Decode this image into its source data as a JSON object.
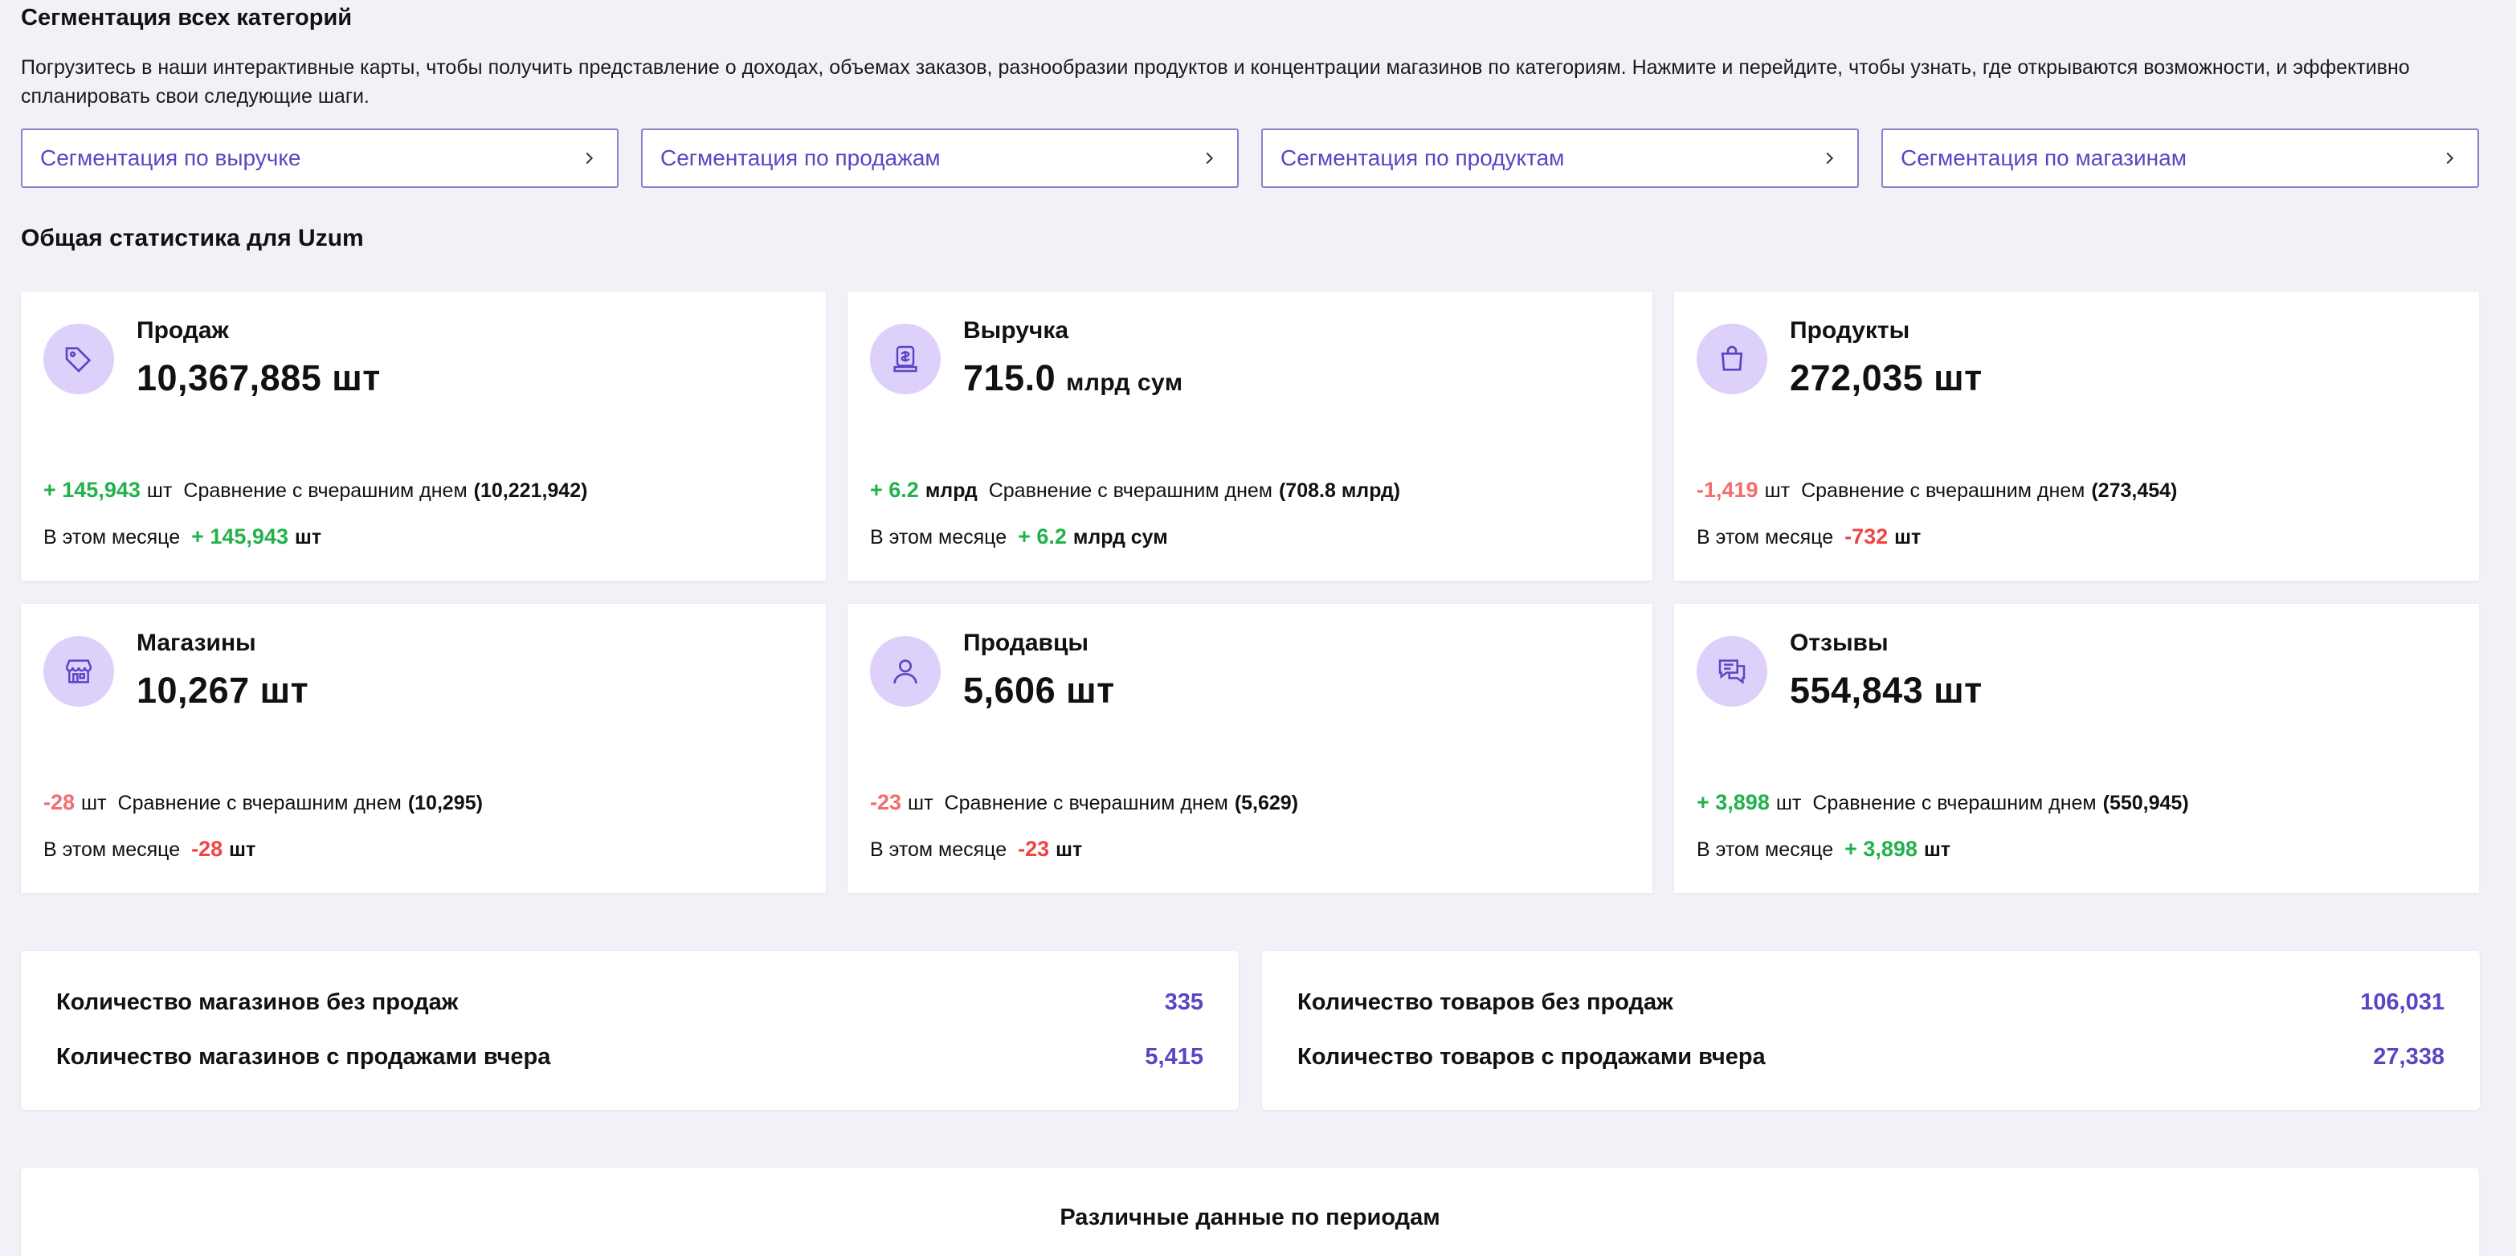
{
  "segmentation": {
    "title": "Сегментация всех категорий",
    "description": "Погрузитесь в наши интерактивные карты, чтобы получить представление о доходах, объемах заказов, разнообразии продуктов и концентрации магазинов по категориям. Нажмите и перейдите, чтобы узнать, где открываются возможности, и эффективно спланировать свои следующие шаги.",
    "buttons": [
      {
        "label": "Сегментация по выручке"
      },
      {
        "label": "Сегментация по продажам"
      },
      {
        "label": "Сегментация по продуктам"
      },
      {
        "label": "Сегментация по магазинам"
      }
    ]
  },
  "stats": {
    "title": "Общая статистика для Uzum",
    "compare_text": "Сравнение с вчерашним днем",
    "month_text": "В этом месяце",
    "cards": [
      {
        "icon": "tag-icon",
        "label": "Продаж",
        "value": "10,367,885 шт",
        "value_unit": "",
        "delta": "+ 145,943",
        "delta_unit": "шт",
        "prev": "(10,221,942)",
        "month_delta": "+ 145,943",
        "month_unit": "шт"
      },
      {
        "icon": "money-icon",
        "label": "Выручка",
        "value": "715.0",
        "value_unit": "млрд сум",
        "delta": "+ 6.2",
        "delta_unit": "млрд",
        "prev": "(708.8 млрд)",
        "month_delta": "+ 6.2",
        "month_unit": "млрд сум"
      },
      {
        "icon": "bag-icon",
        "label": "Продукты",
        "value": "272,035 шт",
        "value_unit": "",
        "delta": "-1,419",
        "delta_unit": "шт",
        "prev": "(273,454)",
        "month_delta": "-732",
        "month_unit": "шт"
      },
      {
        "icon": "store-icon",
        "label": "Магазины",
        "value": "10,267 шт",
        "value_unit": "",
        "delta": "-28",
        "delta_unit": "шт",
        "prev": "(10,295)",
        "month_delta": "-28",
        "month_unit": "шт"
      },
      {
        "icon": "user-icon",
        "label": "Продавцы",
        "value": "5,606 шт",
        "value_unit": "",
        "delta": "-23",
        "delta_unit": "шт",
        "prev": "(5,629)",
        "month_delta": "-23",
        "month_unit": "шт"
      },
      {
        "icon": "chat-icon",
        "label": "Отзывы",
        "value": "554,843 шт",
        "value_unit": "",
        "delta": "+ 3,898",
        "delta_unit": "шт",
        "prev": "(550,945)",
        "month_delta": "+ 3,898",
        "month_unit": "шт"
      }
    ]
  },
  "summary": {
    "stores": [
      {
        "label": "Количество магазинов без продаж",
        "value": "335"
      },
      {
        "label": "Количество магазинов с продажами вчера",
        "value": "5,415"
      }
    ],
    "products": [
      {
        "label": "Количество товаров без продаж",
        "value": "106,031"
      },
      {
        "label": "Количество товаров с продажами вчера",
        "value": "27,338"
      }
    ]
  },
  "period": {
    "title": "Различные данные по периодам"
  },
  "colors": {
    "accent": "#5a46c4",
    "positive": "#22b14c",
    "negative": "#ef4444",
    "icon_bg": "#ddd0fb",
    "background": "#f0f2f7"
  }
}
